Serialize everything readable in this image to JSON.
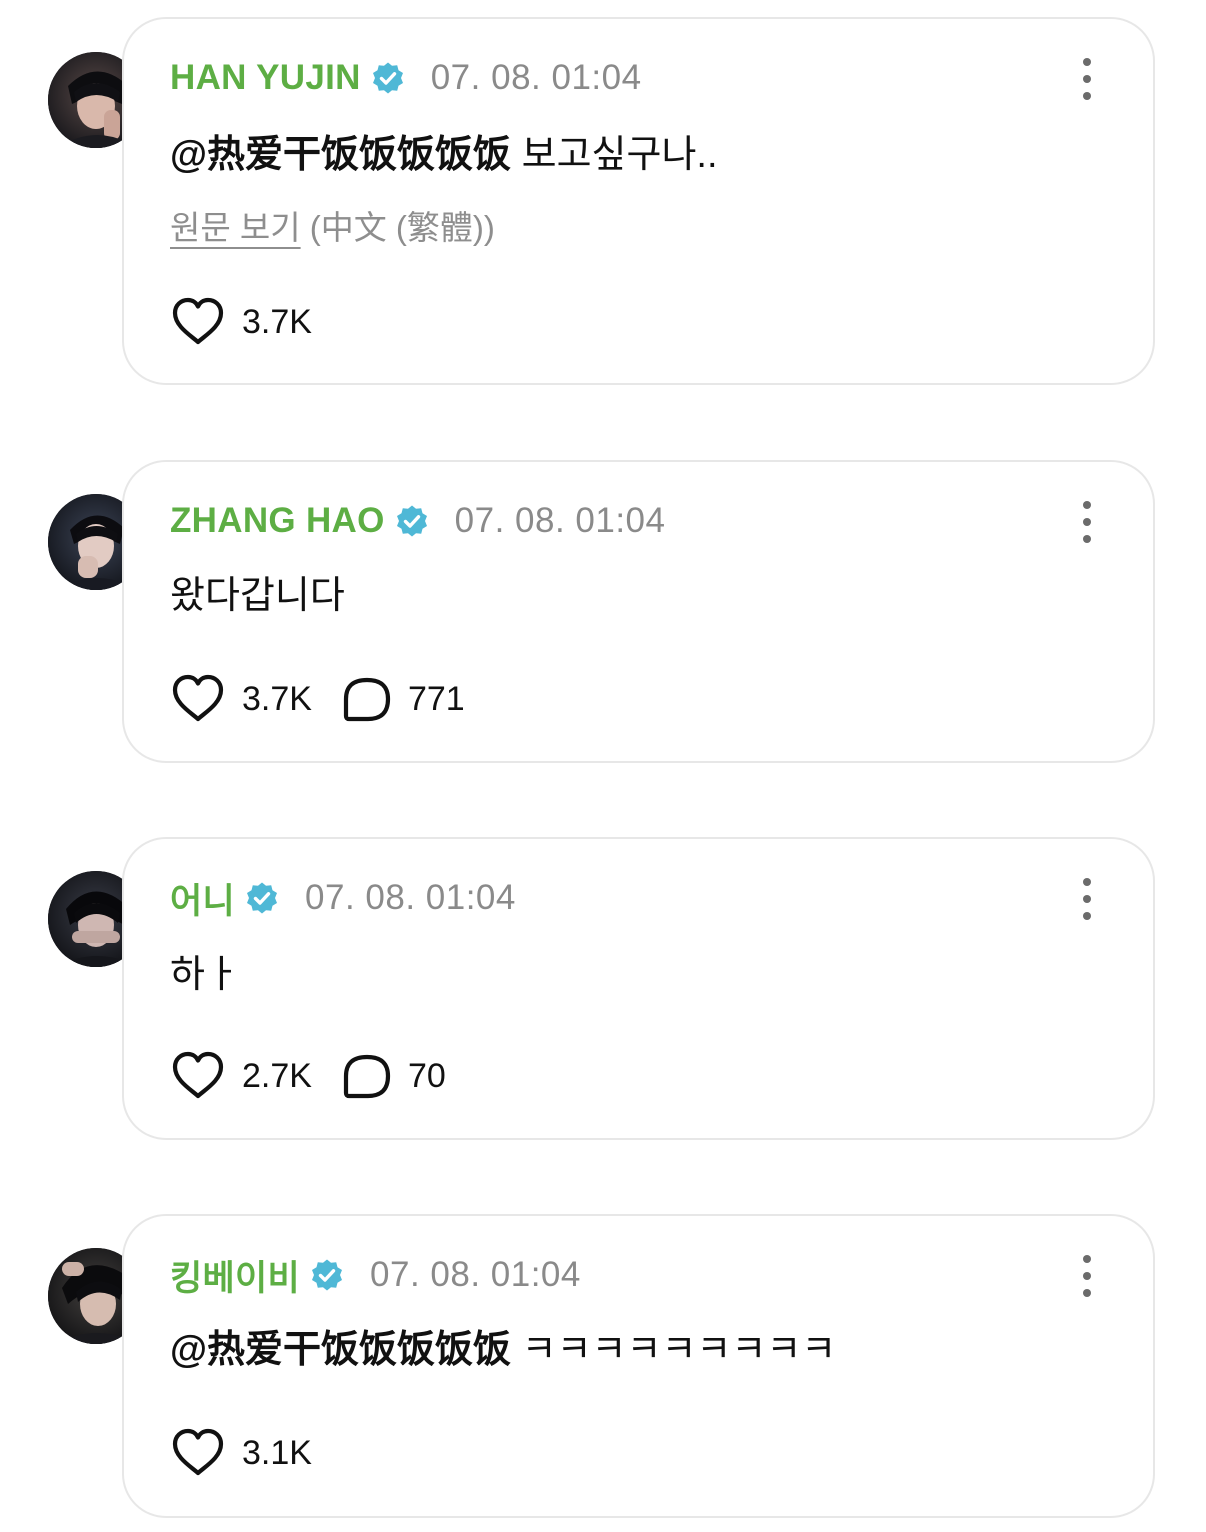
{
  "colors": {
    "username": "#5dae44",
    "verified_badge": "#4fb8d6",
    "timestamp": "#8a8a8a",
    "translate_link": "#8e8e8e",
    "card_border": "#e7e7e7"
  },
  "icons": {
    "verified": "verified-badge-icon",
    "more": "vertical-ellipsis-icon",
    "like": "heart-outline-icon",
    "comment": "speech-bubble-icon"
  },
  "posts": [
    {
      "username": "HAN YUJIN",
      "timestamp": "07. 08. 01:04",
      "mention": "@热爱干饭饭饭饭饭",
      "text": " 보고싶구나..",
      "translate_link": "원문 보기",
      "translate_lang": " (中文 (繁體))",
      "likes": "3.7K"
    },
    {
      "username": "ZHANG HAO",
      "timestamp": "07. 08. 01:04",
      "text": "왔다갑니다",
      "likes": "3.7K",
      "comments": "771"
    },
    {
      "username": "어니",
      "timestamp": "07. 08. 01:04",
      "text": "하ㅏ",
      "likes": "2.7K",
      "comments": "70"
    },
    {
      "username": "킹베이비",
      "timestamp": "07. 08. 01:04",
      "mention": "@热爱干饭饭饭饭饭",
      "text": " ㅋㅋㅋㅋㅋㅋㅋㅋㅋ",
      "likes": "3.1K"
    }
  ]
}
